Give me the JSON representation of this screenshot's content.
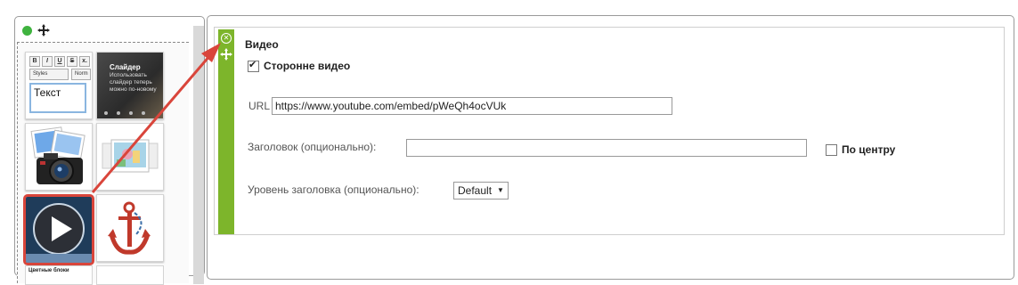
{
  "palette": {
    "text_tile": {
      "bold": "B",
      "italic": "I",
      "underline": "U",
      "strike": "S",
      "more": "x.",
      "styles": "Styles",
      "normal": "Norm",
      "text": "Текст"
    },
    "slider_tile": {
      "title": "Слайдер",
      "subtitle": "Использовать слайдер теперь можно по-новому"
    },
    "partial_label": "Цветные блоки"
  },
  "editor": {
    "title": "Видео",
    "third_party_label": "Сторонне видео",
    "third_party_checked": true,
    "url_label": "URL",
    "url_value": "https://www.youtube.com/embed/pWeQh4ocVUk",
    "heading_label": "Заголовок (опционально):",
    "heading_value": "",
    "center_label": "По центру",
    "center_checked": false,
    "level_label": "Уровень заголовка (опционально):",
    "level_value": "Default"
  },
  "colors": {
    "accent_green": "#7db52b",
    "status_green": "#3fb33f",
    "highlight_red": "#d9453b"
  }
}
